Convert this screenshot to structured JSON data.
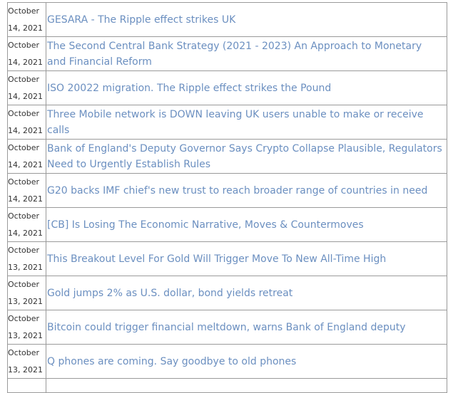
{
  "news": {
    "link_color": "#6b8fc0",
    "rows": [
      {
        "date_line1": "October",
        "date_line2": "14, 2021",
        "title": "GESARA - The Ripple effect strikes UK"
      },
      {
        "date_line1": "October",
        "date_line2": "14, 2021",
        "title": "The Second Central Bank Strategy (2021 - 2023) An Approach to Monetary and Financial Reform"
      },
      {
        "date_line1": "October",
        "date_line2": "14, 2021",
        "title": "ISO 20022 migration. The Ripple effect strikes the Pound"
      },
      {
        "date_line1": "October",
        "date_line2": "14, 2021",
        "title": "Three Mobile network is DOWN leaving UK users unable to make or receive calls"
      },
      {
        "date_line1": "October",
        "date_line2": "14, 2021",
        "title": "Bank of England's Deputy Governor Says Crypto Collapse Plausible, Regulators Need to Urgently Establish Rules"
      },
      {
        "date_line1": "October",
        "date_line2": "14, 2021",
        "title": "G20 backs IMF chief's new trust to reach broader range of countries in need"
      },
      {
        "date_line1": "October",
        "date_line2": "14, 2021",
        "title": "[CB] Is Losing The Economic Narrative, Moves & Countermoves"
      },
      {
        "date_line1": "October",
        "date_line2": "13, 2021",
        "title": "This Breakout Level For Gold Will Trigger Move To New All-Time High"
      },
      {
        "date_line1": "October",
        "date_line2": "13, 2021",
        "title": "Gold jumps 2% as U.S. dollar, bond yields retreat"
      },
      {
        "date_line1": "October",
        "date_line2": "13, 2021",
        "title": "Bitcoin could trigger financial meltdown, warns Bank of England deputy"
      },
      {
        "date_line1": "October",
        "date_line2": "13, 2021",
        "title": "Q phones are coming. Say goodbye to old phones"
      }
    ]
  }
}
